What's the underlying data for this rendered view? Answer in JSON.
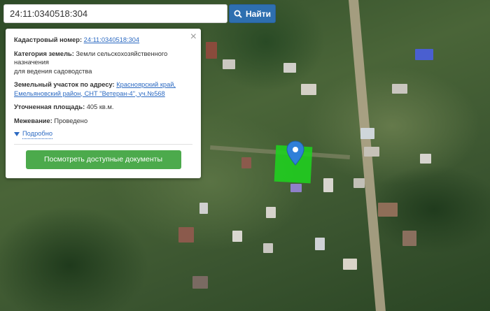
{
  "search": {
    "value": "24:11:0340518:304",
    "button_label": "Найти"
  },
  "popup": {
    "cadastral_label": "Кадастровый номер:",
    "cadastral_value": "24:11:0340518:304",
    "category_label": "Категория земель:",
    "category_value": "Земли сельскохозяйственного назначения",
    "category_value2": "для ведения садоводства",
    "address_label": "Земельный участок по адресу:",
    "address_value1": "Красноярский край,",
    "address_value2": "Емельяновский район, СНТ \"Ветеран-4\", уч.№568",
    "area_label": "Уточненная площадь:",
    "area_value": "405 кв.м.",
    "survey_label": "Межевание:",
    "survey_value": "Проведено",
    "details_label": "Подробно",
    "docs_button_label": "Посмотреть доступные документы",
    "close_icon": "×"
  },
  "colors": {
    "parcel": "#1fd21f",
    "pin": "#2f7fd8",
    "search_button": "#2e6fb0",
    "docs_button": "#4caa4c",
    "link": "#2c6ac2"
  }
}
